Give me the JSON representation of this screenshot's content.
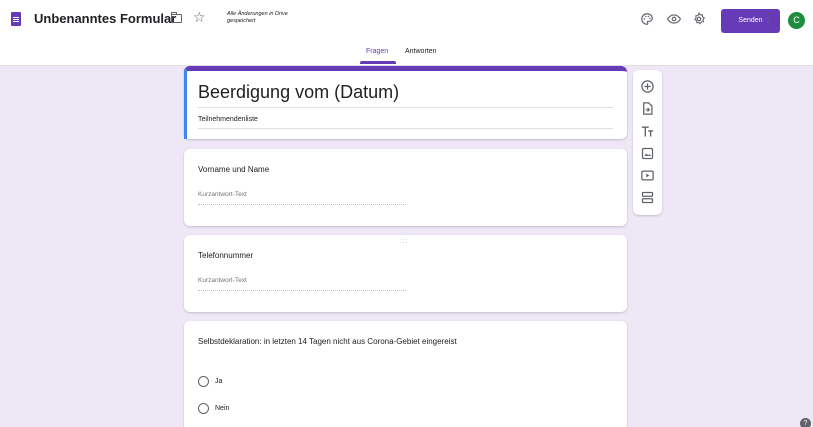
{
  "header": {
    "doc_icon": "forms-doc-icon",
    "title": "Unbenanntes Formular",
    "save_status": "Alle Änderungen in Drive gespeichert",
    "send_label": "Senden",
    "avatar_letter": "C",
    "icons": [
      "folder-icon",
      "star-icon",
      "palette-icon",
      "eye-icon",
      "gear-icon",
      "more-vert-icon"
    ]
  },
  "tabs": [
    {
      "label": "Fragen",
      "active": true
    },
    {
      "label": "Antworten",
      "active": false
    }
  ],
  "form": {
    "title": "Beerdigung vom (Datum)",
    "description": "Teilnehmendenliste"
  },
  "questions": [
    {
      "label": "Vorname und Name",
      "type": "short_answer",
      "placeholder": "Kurzantwort-Text"
    },
    {
      "label": "Telefonnummer",
      "type": "short_answer",
      "placeholder": "Kurzantwort-Text"
    },
    {
      "label": "Selbstdeklaration: in letzten 14 Tagen nicht aus Corona-Gebiet eingereist",
      "type": "multiple_choice",
      "options": [
        "Ja",
        "Nein"
      ]
    }
  ],
  "toolbar": {
    "icons": [
      "add-question-icon",
      "import-question-icon",
      "title-text-icon",
      "image-icon",
      "video-icon",
      "section-icon"
    ]
  },
  "colors": {
    "accent": "#673ab7",
    "background": "#ede7f6",
    "active_card": "#4285f4",
    "avatar": "#1e8e3e"
  }
}
